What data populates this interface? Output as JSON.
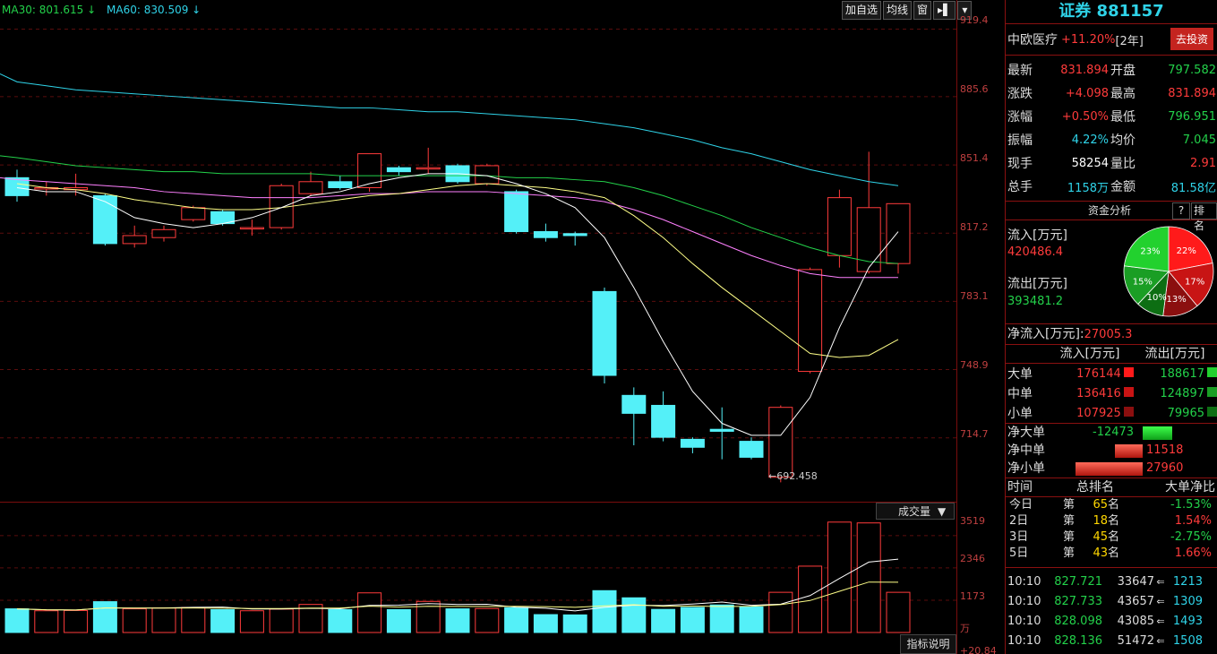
{
  "chart": {
    "ma_legend": [
      {
        "label": "MA30: 801.615",
        "arrow": "↓",
        "color": "#23d14a"
      },
      {
        "label": "MA60: 830.509",
        "arrow": "↓",
        "color": "#2fd3e8"
      }
    ],
    "toolbar": [
      "加自选",
      "均线",
      "窗"
    ],
    "price_axis": [
      "919.4",
      "885.6",
      "851.4",
      "817.2",
      "783.1",
      "748.9",
      "714.7"
    ],
    "low_marker": "692.458",
    "volume_dropdown": "成交量",
    "volume_axis": [
      "3519",
      "2346",
      "1173"
    ],
    "volume_unit": "万",
    "volume_bottom": "+20.84",
    "indicator_button": "指标说明",
    "colors": {
      "up": "#ff3b3b",
      "down": "#54f0f8",
      "ma5": "#ffffff",
      "ma10": "#ffff88",
      "ma20": "#ff80ff",
      "ma30": "#23d14a",
      "ma60": "#2fd3e8"
    }
  },
  "chart_data": {
    "type": "candlestick",
    "ylim": [
      685,
      925
    ],
    "candles": [
      {
        "o": 845,
        "c": 836,
        "h": 849,
        "l": 833
      },
      {
        "o": 840,
        "c": 840,
        "h": 843,
        "l": 836
      },
      {
        "o": 839,
        "c": 840,
        "h": 847,
        "l": 836
      },
      {
        "o": 836,
        "c": 812,
        "h": 837,
        "l": 811
      },
      {
        "o": 812,
        "c": 816,
        "h": 821,
        "l": 810
      },
      {
        "o": 815,
        "c": 819,
        "h": 821,
        "l": 813
      },
      {
        "o": 824,
        "c": 830,
        "h": 831,
        "l": 823
      },
      {
        "o": 828,
        "c": 822,
        "h": 829,
        "l": 821
      },
      {
        "o": 820,
        "c": 820,
        "h": 824,
        "l": 816
      },
      {
        "o": 820,
        "c": 841,
        "h": 842,
        "l": 819
      },
      {
        "o": 837,
        "c": 843,
        "h": 848,
        "l": 836
      },
      {
        "o": 843,
        "c": 840,
        "h": 846,
        "l": 839
      },
      {
        "o": 840,
        "c": 857,
        "h": 857,
        "l": 838
      },
      {
        "o": 850,
        "c": 848,
        "h": 851,
        "l": 846
      },
      {
        "o": 850,
        "c": 850,
        "h": 860,
        "l": 847
      },
      {
        "o": 851,
        "c": 843,
        "h": 852,
        "l": 842
      },
      {
        "o": 842,
        "c": 851,
        "h": 852,
        "l": 841
      },
      {
        "o": 838,
        "c": 818,
        "h": 839,
        "l": 817
      },
      {
        "o": 818,
        "c": 815,
        "h": 822,
        "l": 813
      },
      {
        "o": 817,
        "c": 816,
        "h": 818,
        "l": 811
      },
      {
        "o": 788,
        "c": 746,
        "h": 790,
        "l": 742
      },
      {
        "o": 736,
        "c": 727,
        "h": 740,
        "l": 711
      },
      {
        "o": 731,
        "c": 715,
        "h": 738,
        "l": 713
      },
      {
        "o": 714,
        "c": 710,
        "h": 715,
        "l": 707
      },
      {
        "o": 719,
        "c": 718,
        "h": 730,
        "l": 704
      },
      {
        "o": 713,
        "c": 705,
        "h": 715,
        "l": 704
      },
      {
        "o": 695,
        "c": 730,
        "h": 731,
        "l": 692.458
      },
      {
        "o": 748,
        "c": 799,
        "h": 800,
        "l": 747
      },
      {
        "o": 806,
        "c": 835,
        "h": 839,
        "l": 800
      },
      {
        "o": 798,
        "c": 830,
        "h": 858,
        "l": 797
      },
      {
        "o": 802,
        "c": 832,
        "h": 832,
        "l": 797
      }
    ],
    "volume": [
      860,
      790,
      800,
      1120,
      860,
      890,
      910,
      830,
      790,
      850,
      1020,
      830,
      1440,
      830,
      1130,
      860,
      870,
      900,
      650,
      640,
      1520,
      1260,
      840,
      910,
      1000,
      930,
      1460,
      2410,
      4010,
      3980,
      1460
    ],
    "volume_ylim": [
      0,
      4100
    ],
    "ma5": [
      840,
      838,
      838,
      833,
      825,
      822,
      820,
      822,
      825,
      830,
      836,
      838,
      842,
      845,
      847,
      847,
      846,
      842,
      837,
      830,
      815,
      790,
      763,
      738,
      722,
      716,
      716,
      735,
      770,
      800,
      818
    ],
    "ma10": [
      842,
      840,
      839,
      837,
      834,
      832,
      830,
      829,
      829,
      830,
      832,
      834,
      836,
      837,
      839,
      841,
      842,
      841,
      840,
      838,
      835,
      826,
      815,
      802,
      790,
      779,
      768,
      757,
      755,
      756,
      764
    ],
    "ma20": [
      844,
      843,
      842,
      841,
      840,
      838,
      837,
      836,
      835,
      835,
      835,
      836,
      837,
      837,
      838,
      838,
      838,
      837,
      836,
      835,
      833,
      829,
      824,
      818,
      812,
      806,
      801,
      797,
      795,
      795,
      795
    ],
    "ma30": [
      855,
      853,
      851,
      850,
      849,
      848,
      848,
      847,
      847,
      847,
      847,
      846,
      846,
      846,
      846,
      846,
      846,
      845,
      845,
      844,
      843,
      840,
      836,
      831,
      826,
      820,
      815,
      810,
      806,
      803,
      802
    ],
    "ma60": [
      893,
      891,
      889,
      888,
      887,
      886,
      885,
      884,
      883,
      882,
      881,
      880,
      880,
      879,
      878,
      878,
      877,
      876,
      875,
      874,
      872,
      870,
      867,
      864,
      860,
      857,
      853,
      849,
      846,
      843,
      841
    ]
  },
  "panel": {
    "title": "证券 881157",
    "fund": {
      "name": "中欧医疗",
      "pct": "+11.20%",
      "period": "[2年]",
      "button": "去投资"
    },
    "quote": [
      {
        "l1": "最新",
        "v1": "831.894",
        "c1": "red",
        "l2": "开盘",
        "v2": "797.582",
        "c2": "green"
      },
      {
        "l1": "涨跌",
        "v1": "+4.098",
        "c1": "red",
        "l2": "最高",
        "v2": "831.894",
        "c2": "red"
      },
      {
        "l1": "涨幅",
        "v1": "+0.50%",
        "c1": "red",
        "l2": "最低",
        "v2": "796.951",
        "c2": "green"
      },
      {
        "l1": "振幅",
        "v1": "4.22%",
        "c1": "cyan",
        "l2": "均价",
        "v2": "7.045",
        "c2": "green"
      },
      {
        "l1": "现手",
        "v1": "58254",
        "c1": "white",
        "l2": "量比",
        "v2": "2.91",
        "c2": "red"
      },
      {
        "l1": "总手",
        "v1": "1158万",
        "c1": "cyan",
        "l2": "金额",
        "v2": "81.58亿",
        "c2": "cyan"
      }
    ],
    "fund_flow": {
      "header": "资金分析",
      "help": "?",
      "rank": "排名",
      "inflow_label": "流入[万元]",
      "inflow": "420486.4",
      "outflow_label": "流出[万元]",
      "outflow": "393481.2",
      "pie": [
        {
          "pct": 22,
          "label": "22%",
          "color": "#ff1a1a"
        },
        {
          "pct": 17,
          "label": "17%",
          "color": "#c81414"
        },
        {
          "pct": 13,
          "label": "13%",
          "color": "#8b0f0f"
        },
        {
          "pct": 10,
          "label": "10%",
          "color": "#0d6e13"
        },
        {
          "pct": 15,
          "label": "15%",
          "color": "#1a9e24"
        },
        {
          "pct": 23,
          "label": "23%",
          "color": "#22d12e"
        }
      ],
      "net_label": "净流入[万元]:",
      "net_value": "27005.3"
    },
    "order_table": {
      "head_in": "流入[万元]",
      "head_out": "流出[万元]",
      "rows": [
        {
          "label": "大单",
          "in": "176144",
          "out": "188617",
          "in_color": "#ff1a1a",
          "out_color": "#22d12e"
        },
        {
          "label": "中单",
          "in": "136416",
          "out": "124897",
          "in_color": "#c81414",
          "out_color": "#1a9e24"
        },
        {
          "label": "小单",
          "in": "107925",
          "out": "79965",
          "in_color": "#8b0f0f",
          "out_color": "#0d6e13"
        }
      ]
    },
    "net_bars": [
      {
        "label": "净大单",
        "value": "-12473",
        "amount": -12473
      },
      {
        "label": "净中单",
        "value": "11518",
        "amount": 11518
      },
      {
        "label": "净小单",
        "value": "27960",
        "amount": 27960
      }
    ],
    "ranking": {
      "headers": [
        "时间",
        "总排名",
        "大单净比"
      ],
      "rows": [
        {
          "day": "今日",
          "pre": "第",
          "rank": "65",
          "suf": "名",
          "ratio": "-1.53%",
          "rc": "green"
        },
        {
          "day": "2日",
          "pre": "第",
          "rank": "18",
          "suf": "名",
          "ratio": "1.54%",
          "rc": "red"
        },
        {
          "day": "3日",
          "pre": "第",
          "rank": "45",
          "suf": "名",
          "ratio": "-2.75%",
          "rc": "green"
        },
        {
          "day": "5日",
          "pre": "第",
          "rank": "43",
          "suf": "名",
          "ratio": "1.66%",
          "rc": "red"
        }
      ]
    },
    "ticks": [
      {
        "time": "10:10",
        "price": "827.721",
        "vol": "33647",
        "arrow": "⇐",
        "v2": "1213"
      },
      {
        "time": "10:10",
        "price": "827.733",
        "vol": "43657",
        "arrow": "⇐",
        "v2": "1309"
      },
      {
        "time": "10:10",
        "price": "828.098",
        "vol": "43085",
        "arrow": "⇐",
        "v2": "1493"
      },
      {
        "time": "10:10",
        "price": "828.136",
        "vol": "51472",
        "arrow": "⇐",
        "v2": "1508"
      }
    ]
  }
}
